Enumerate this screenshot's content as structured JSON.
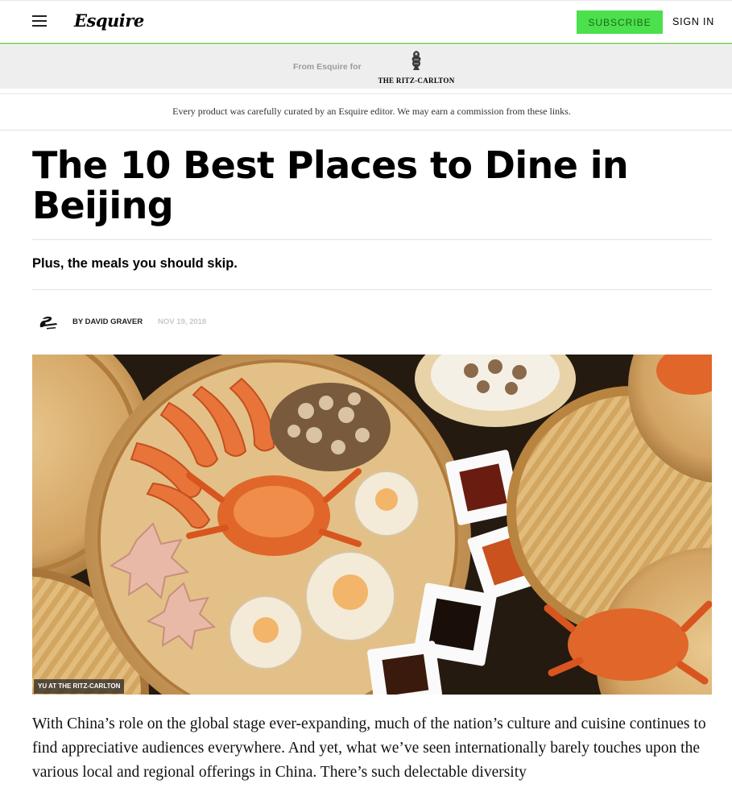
{
  "header": {
    "logo": "Esquire",
    "subscribe_label": "SUBSCRIBE",
    "signin_label": "SIGN IN",
    "accent_color": "#4ce04c"
  },
  "sponsor": {
    "label": "From Esquire for",
    "brand": "THE RITZ-CARLTON"
  },
  "disclaimer": "Every product was carefully curated by an Esquire editor. We may earn a commission from these links.",
  "article": {
    "title": "The 10 Best Places to Dine in Beijing",
    "dek": "Plus, the meals you should skip.",
    "byline": "BY DAVID GRAVER",
    "date": "NOV 19, 2018",
    "image_credit": "YU AT THE RITZ-CARLTON",
    "body": "With China’s role on the global stage ever-expanding, much of the nation’s culture and cuisine continues to find appreciative audiences everywhere. And yet, what we’ve seen internationally barely touches upon the various local and regional offerings in China. There’s such delectable diversity"
  }
}
